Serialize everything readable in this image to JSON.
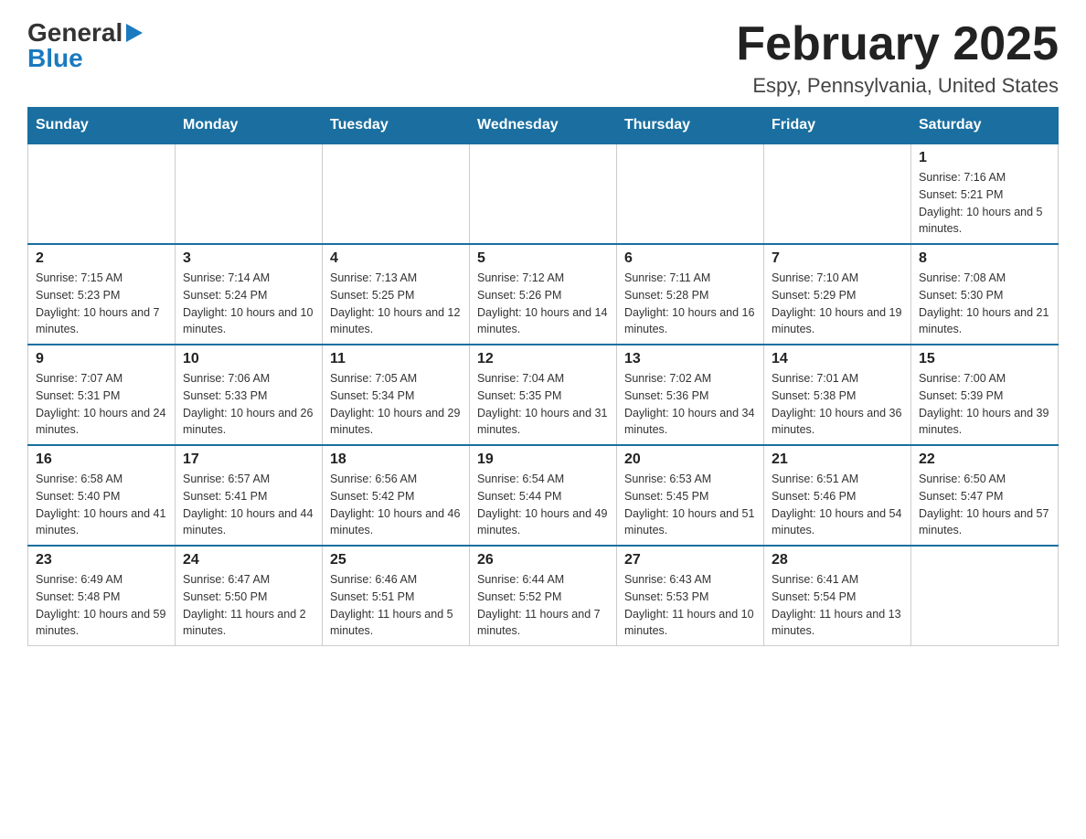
{
  "logo": {
    "line1": "General",
    "line2": "Blue"
  },
  "header": {
    "month_year": "February 2025",
    "location": "Espy, Pennsylvania, United States"
  },
  "weekdays": [
    "Sunday",
    "Monday",
    "Tuesday",
    "Wednesday",
    "Thursday",
    "Friday",
    "Saturday"
  ],
  "weeks": [
    [
      {
        "day": "",
        "info": ""
      },
      {
        "day": "",
        "info": ""
      },
      {
        "day": "",
        "info": ""
      },
      {
        "day": "",
        "info": ""
      },
      {
        "day": "",
        "info": ""
      },
      {
        "day": "",
        "info": ""
      },
      {
        "day": "1",
        "info": "Sunrise: 7:16 AM\nSunset: 5:21 PM\nDaylight: 10 hours and 5 minutes."
      }
    ],
    [
      {
        "day": "2",
        "info": "Sunrise: 7:15 AM\nSunset: 5:23 PM\nDaylight: 10 hours and 7 minutes."
      },
      {
        "day": "3",
        "info": "Sunrise: 7:14 AM\nSunset: 5:24 PM\nDaylight: 10 hours and 10 minutes."
      },
      {
        "day": "4",
        "info": "Sunrise: 7:13 AM\nSunset: 5:25 PM\nDaylight: 10 hours and 12 minutes."
      },
      {
        "day": "5",
        "info": "Sunrise: 7:12 AM\nSunset: 5:26 PM\nDaylight: 10 hours and 14 minutes."
      },
      {
        "day": "6",
        "info": "Sunrise: 7:11 AM\nSunset: 5:28 PM\nDaylight: 10 hours and 16 minutes."
      },
      {
        "day": "7",
        "info": "Sunrise: 7:10 AM\nSunset: 5:29 PM\nDaylight: 10 hours and 19 minutes."
      },
      {
        "day": "8",
        "info": "Sunrise: 7:08 AM\nSunset: 5:30 PM\nDaylight: 10 hours and 21 minutes."
      }
    ],
    [
      {
        "day": "9",
        "info": "Sunrise: 7:07 AM\nSunset: 5:31 PM\nDaylight: 10 hours and 24 minutes."
      },
      {
        "day": "10",
        "info": "Sunrise: 7:06 AM\nSunset: 5:33 PM\nDaylight: 10 hours and 26 minutes."
      },
      {
        "day": "11",
        "info": "Sunrise: 7:05 AM\nSunset: 5:34 PM\nDaylight: 10 hours and 29 minutes."
      },
      {
        "day": "12",
        "info": "Sunrise: 7:04 AM\nSunset: 5:35 PM\nDaylight: 10 hours and 31 minutes."
      },
      {
        "day": "13",
        "info": "Sunrise: 7:02 AM\nSunset: 5:36 PM\nDaylight: 10 hours and 34 minutes."
      },
      {
        "day": "14",
        "info": "Sunrise: 7:01 AM\nSunset: 5:38 PM\nDaylight: 10 hours and 36 minutes."
      },
      {
        "day": "15",
        "info": "Sunrise: 7:00 AM\nSunset: 5:39 PM\nDaylight: 10 hours and 39 minutes."
      }
    ],
    [
      {
        "day": "16",
        "info": "Sunrise: 6:58 AM\nSunset: 5:40 PM\nDaylight: 10 hours and 41 minutes."
      },
      {
        "day": "17",
        "info": "Sunrise: 6:57 AM\nSunset: 5:41 PM\nDaylight: 10 hours and 44 minutes."
      },
      {
        "day": "18",
        "info": "Sunrise: 6:56 AM\nSunset: 5:42 PM\nDaylight: 10 hours and 46 minutes."
      },
      {
        "day": "19",
        "info": "Sunrise: 6:54 AM\nSunset: 5:44 PM\nDaylight: 10 hours and 49 minutes."
      },
      {
        "day": "20",
        "info": "Sunrise: 6:53 AM\nSunset: 5:45 PM\nDaylight: 10 hours and 51 minutes."
      },
      {
        "day": "21",
        "info": "Sunrise: 6:51 AM\nSunset: 5:46 PM\nDaylight: 10 hours and 54 minutes."
      },
      {
        "day": "22",
        "info": "Sunrise: 6:50 AM\nSunset: 5:47 PM\nDaylight: 10 hours and 57 minutes."
      }
    ],
    [
      {
        "day": "23",
        "info": "Sunrise: 6:49 AM\nSunset: 5:48 PM\nDaylight: 10 hours and 59 minutes."
      },
      {
        "day": "24",
        "info": "Sunrise: 6:47 AM\nSunset: 5:50 PM\nDaylight: 11 hours and 2 minutes."
      },
      {
        "day": "25",
        "info": "Sunrise: 6:46 AM\nSunset: 5:51 PM\nDaylight: 11 hours and 5 minutes."
      },
      {
        "day": "26",
        "info": "Sunrise: 6:44 AM\nSunset: 5:52 PM\nDaylight: 11 hours and 7 minutes."
      },
      {
        "day": "27",
        "info": "Sunrise: 6:43 AM\nSunset: 5:53 PM\nDaylight: 11 hours and 10 minutes."
      },
      {
        "day": "28",
        "info": "Sunrise: 6:41 AM\nSunset: 5:54 PM\nDaylight: 11 hours and 13 minutes."
      },
      {
        "day": "",
        "info": ""
      }
    ]
  ]
}
